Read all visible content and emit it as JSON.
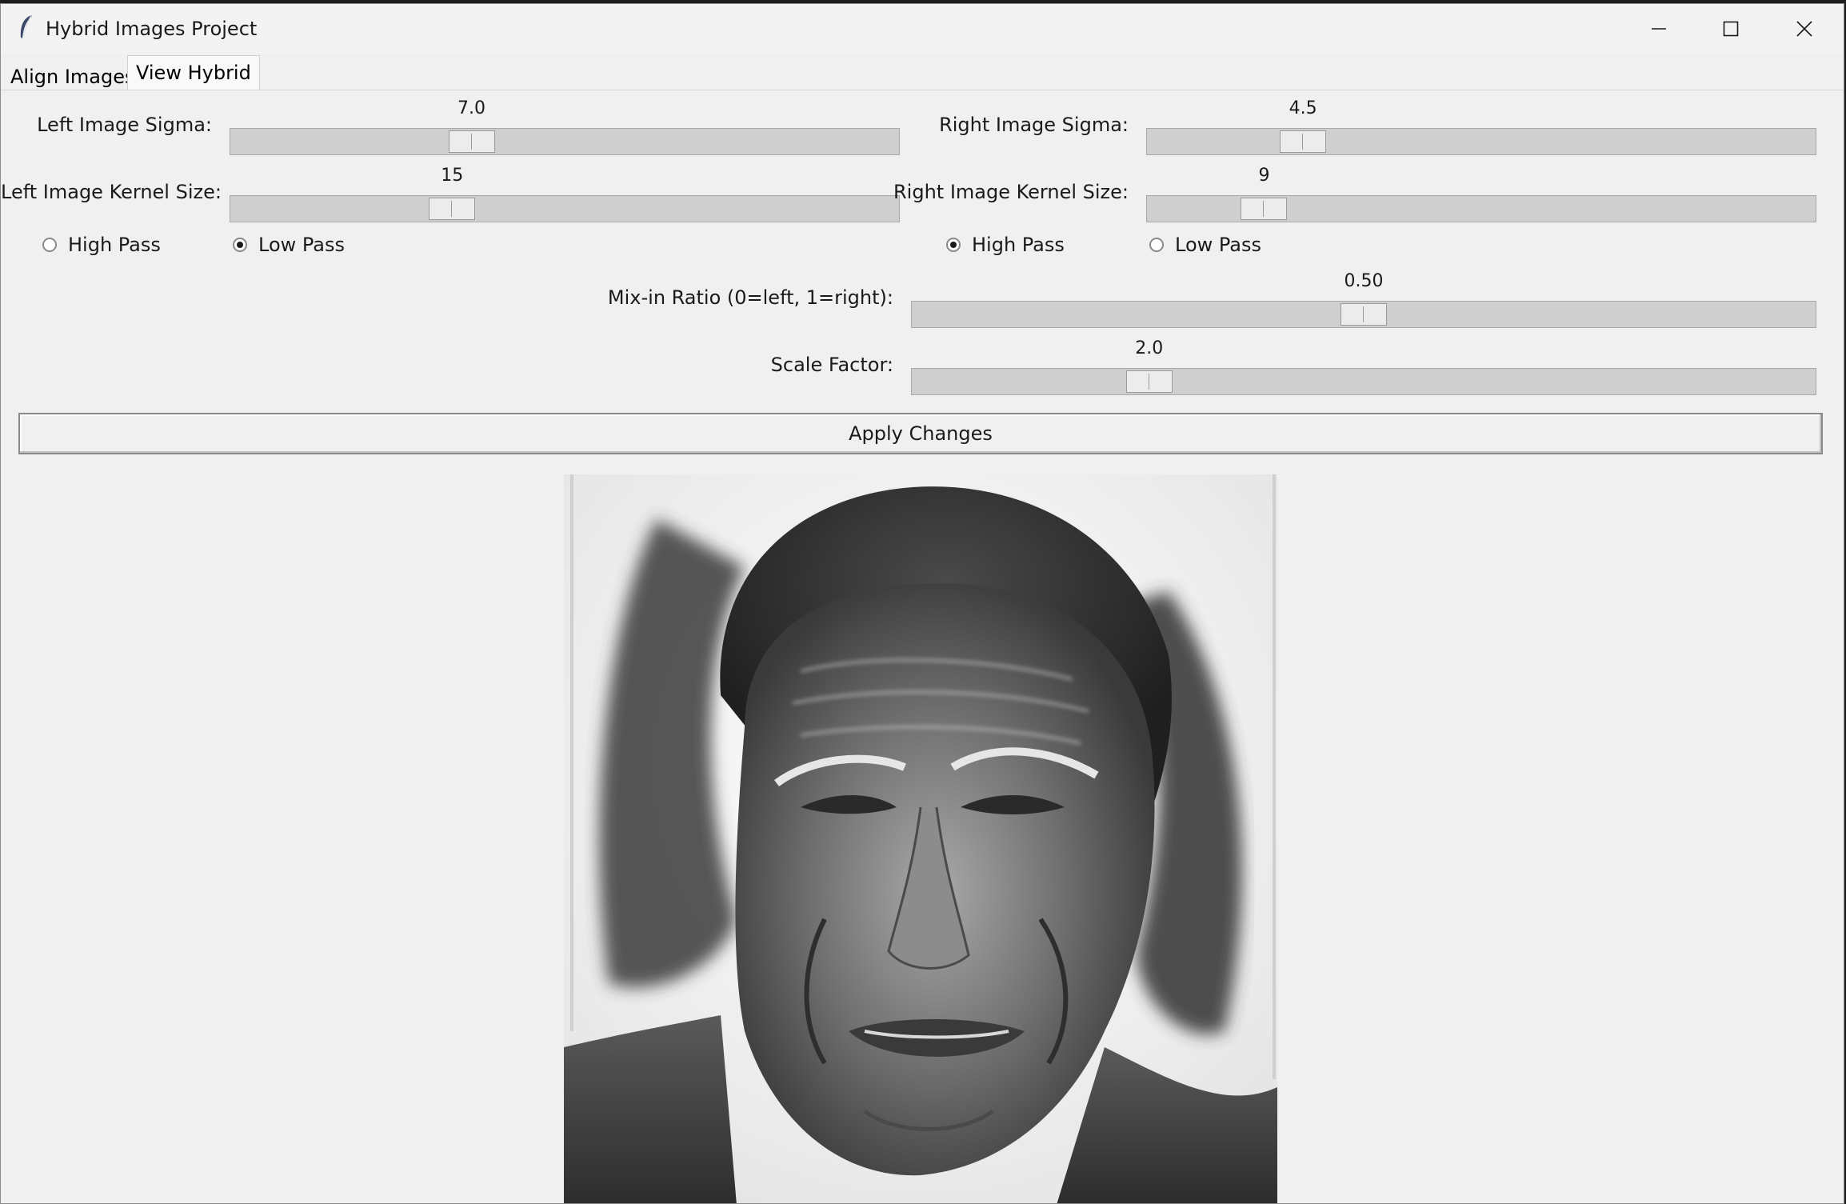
{
  "window": {
    "title": "Hybrid Images Project",
    "controls": [
      "minimize-icon",
      "maximize-icon",
      "close-icon"
    ]
  },
  "tabs": [
    {
      "label": "Align Images",
      "active": false
    },
    {
      "label": "View Hybrid",
      "active": true
    }
  ],
  "left": {
    "sigma_label": "Left Image Sigma:",
    "sigma_value": "7.0",
    "kernel_label": "Left Image Kernel Size:",
    "kernel_value": "15",
    "high_pass_label": "High Pass",
    "low_pass_label": "Low Pass",
    "selected_filter": "Low Pass"
  },
  "right": {
    "sigma_label": "Right Image Sigma:",
    "sigma_value": "4.5",
    "kernel_label": "Right Image Kernel Size:",
    "kernel_value": "9",
    "high_pass_label": "High Pass",
    "low_pass_label": "Low Pass",
    "selected_filter": "High Pass"
  },
  "mix": {
    "label": "Mix-in Ratio (0=left, 1=right):",
    "value": "0.50"
  },
  "scale": {
    "label": "Scale Factor:",
    "value": "2.0"
  },
  "apply_label": "Apply Changes",
  "colors": {
    "window_bg": "#f0f0f0",
    "trough": "#cfcfcf",
    "thumb": "#ececec"
  }
}
